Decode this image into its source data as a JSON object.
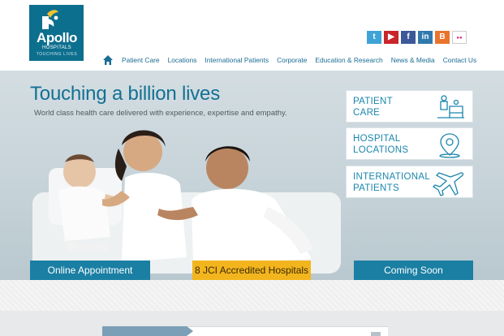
{
  "brand": {
    "name": "Apollo",
    "sub": "HOSPITALS",
    "tagline": "TOUCHING LIVES",
    "color": "#0d6f8e"
  },
  "social": [
    {
      "name": "twitter",
      "glyph": "t"
    },
    {
      "name": "youtube",
      "glyph": "▶"
    },
    {
      "name": "facebook",
      "glyph": "f"
    },
    {
      "name": "linkedin",
      "glyph": "in"
    },
    {
      "name": "blogger",
      "glyph": "B"
    },
    {
      "name": "flickr",
      "glyph": "●●"
    }
  ],
  "nav": {
    "items": [
      "Patient Care",
      "Locations",
      "International Patients",
      "Corporate",
      "Education & Research",
      "News & Media",
      "Contact Us"
    ]
  },
  "hero": {
    "title": "Touching a billion lives",
    "subtitle": "World class health care delivered with experience, expertise and empathy."
  },
  "quick_links": [
    {
      "label": "PATIENT\nCARE",
      "icon": "patient-care-icon"
    },
    {
      "label": "HOSPITAL\nLOCATIONS",
      "icon": "location-pin-icon"
    },
    {
      "label": "INTERNATIONAL\nPATIENTS",
      "icon": "airplane-icon"
    }
  ],
  "bottom_bar": {
    "online": "Online Appointment",
    "jci": "8 JCI Accredited Hospitals",
    "soon": "Coming Soon"
  },
  "colors": {
    "accent": "#1a7fa3",
    "highlight": "#f3b51e",
    "nav_text": "#1a6d94"
  }
}
